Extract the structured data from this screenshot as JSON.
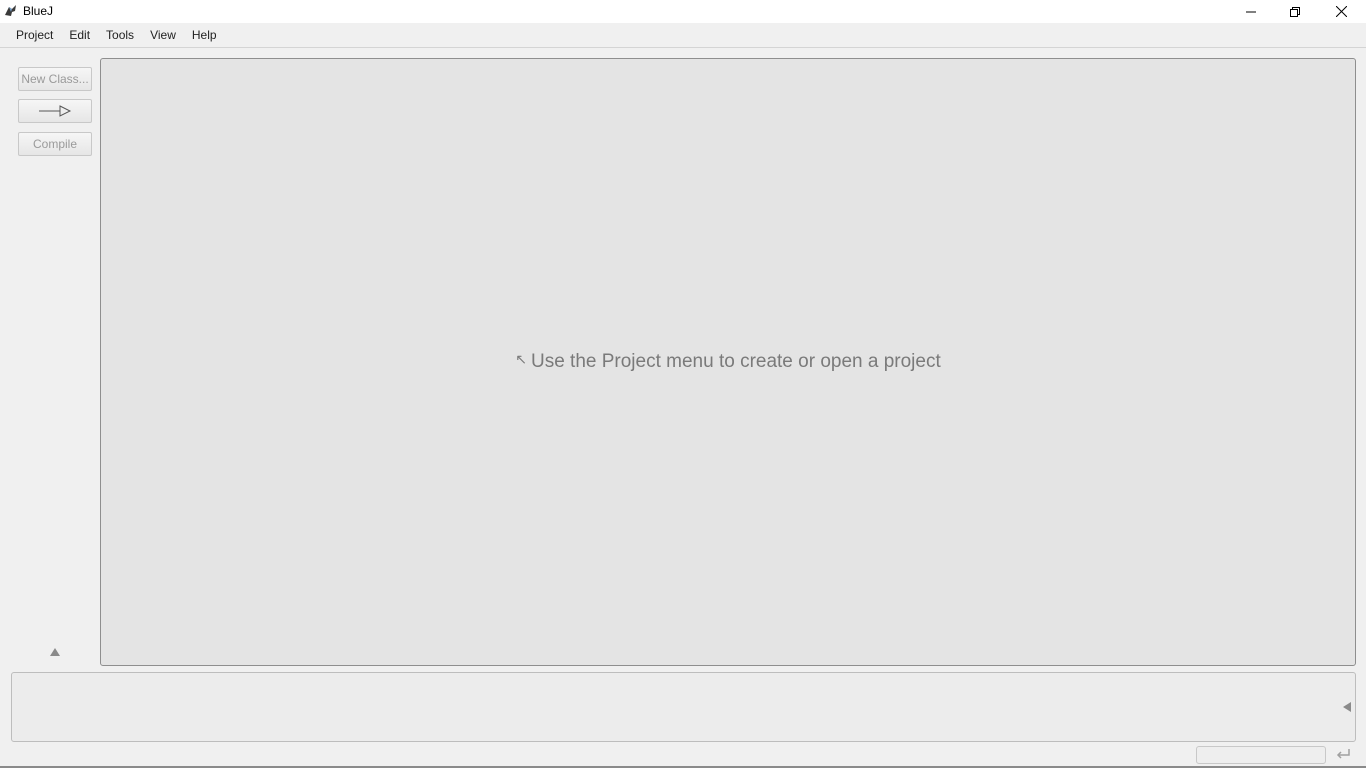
{
  "window": {
    "title": "BlueJ"
  },
  "menubar": {
    "items": [
      "Project",
      "Edit",
      "Tools",
      "View",
      "Help"
    ]
  },
  "toolbar": {
    "new_class_label": "New Class...",
    "arrow_icon": "inheritance-arrow-icon",
    "compile_label": "Compile"
  },
  "canvas": {
    "hint_arrow": "↖",
    "hint_text": "Use the Project menu to create or open a project"
  },
  "colors": {
    "canvas_bg": "#e4e4e4",
    "window_bg": "#f0f0f0",
    "disabled_text": "#9a9a9a",
    "hint_text": "#7a7a7a"
  }
}
